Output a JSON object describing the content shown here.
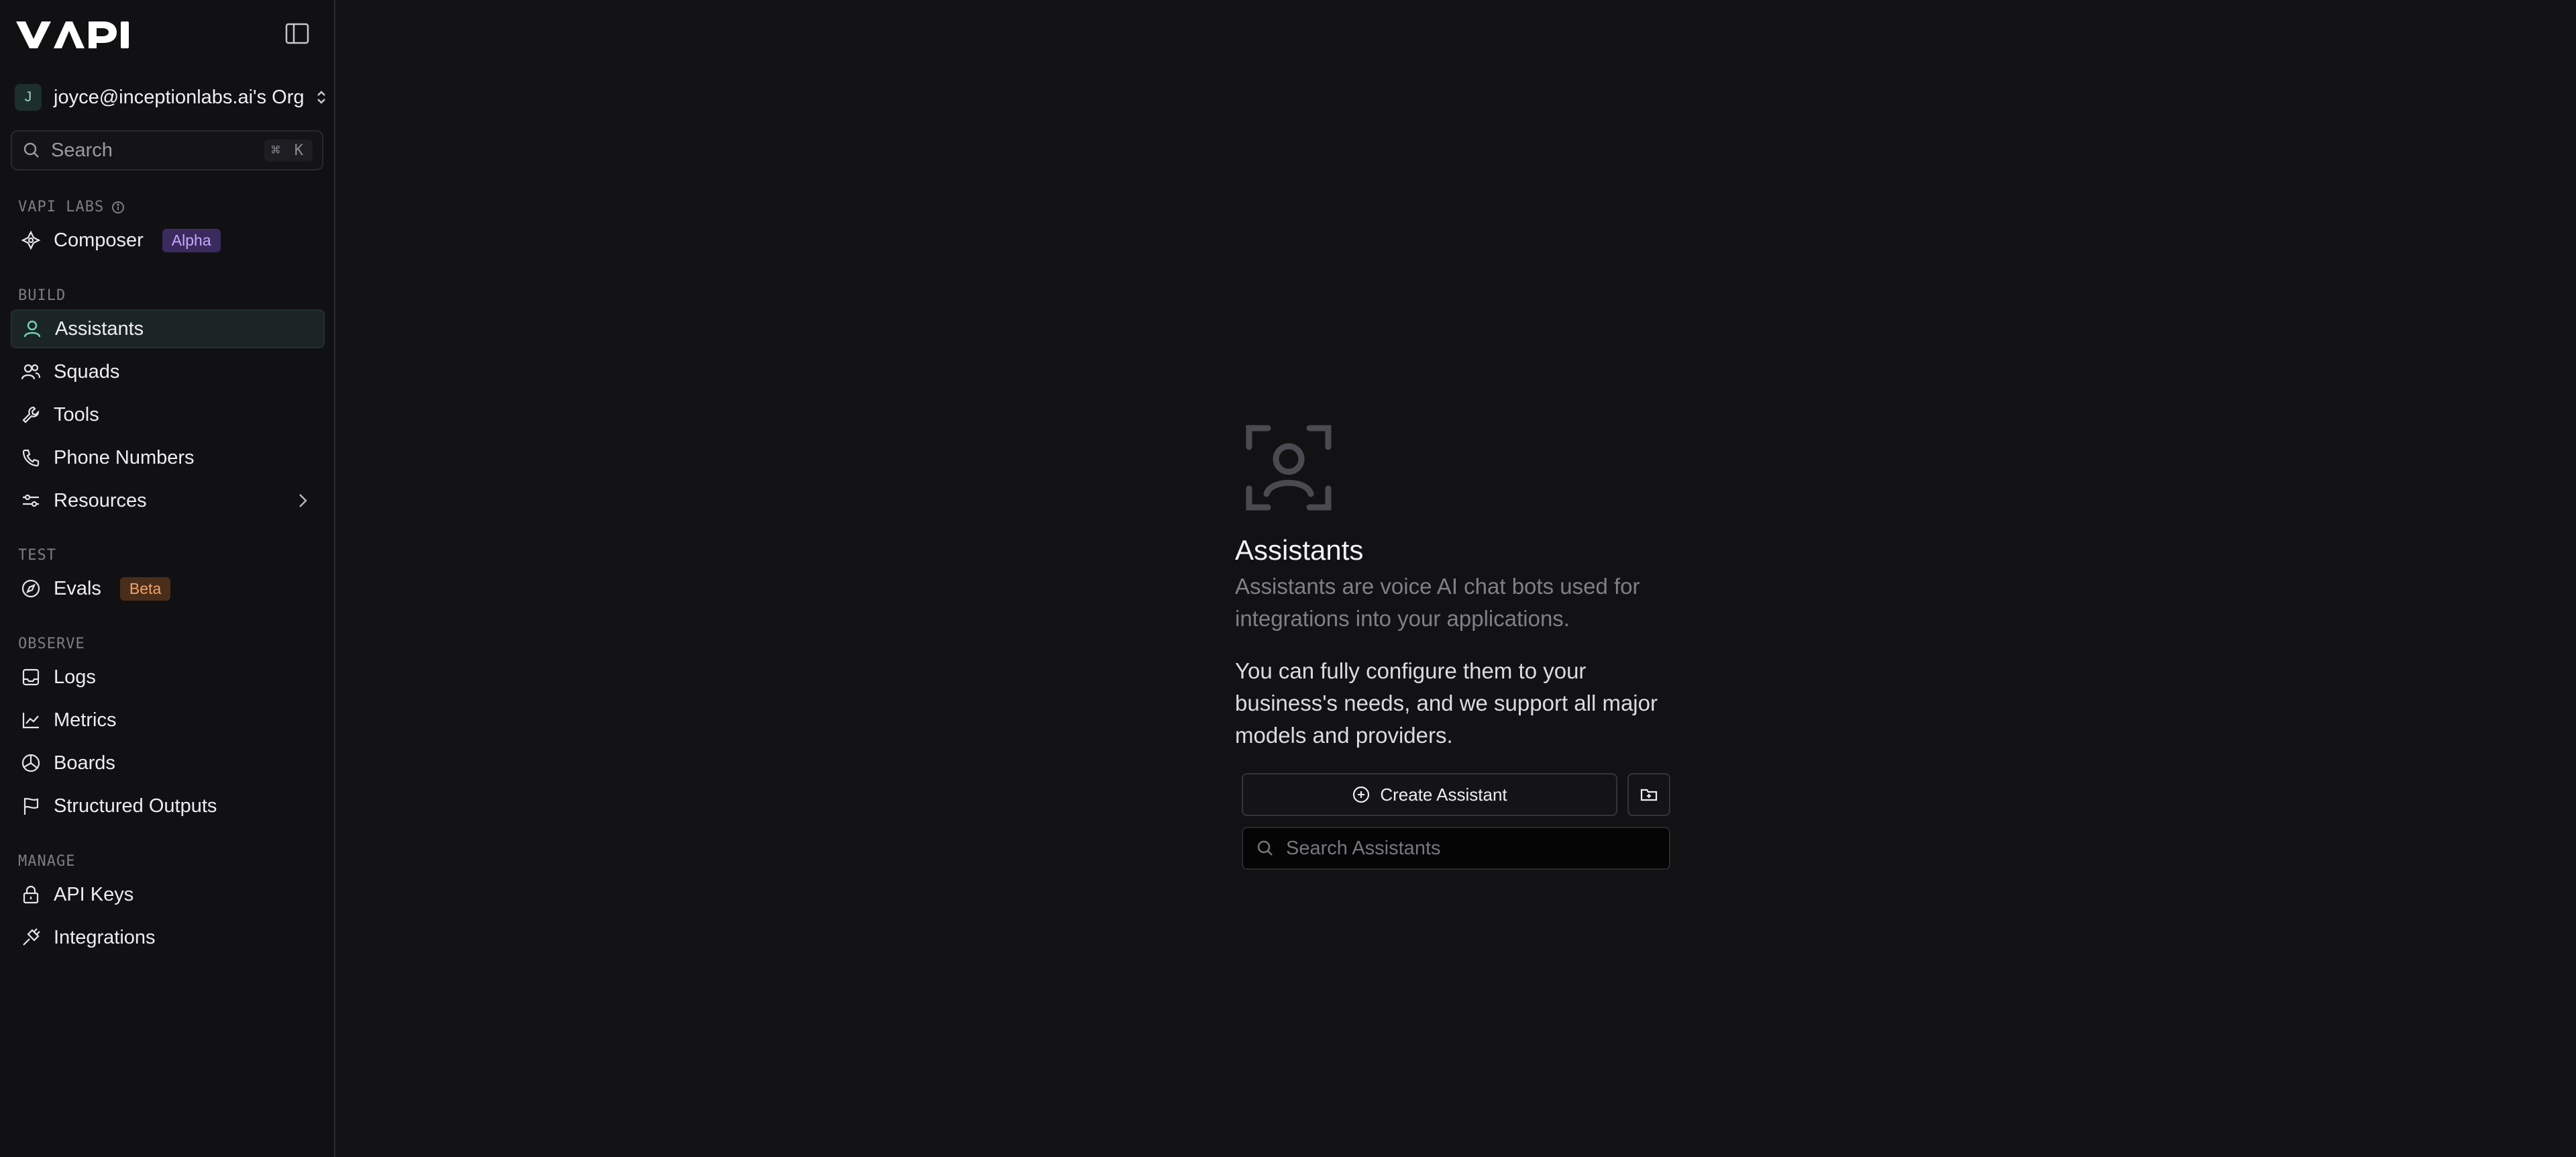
{
  "brand": {
    "logo_text": "VAPI"
  },
  "org": {
    "avatar_letter": "J",
    "name": "joyce@inceptionlabs.ai's Org"
  },
  "search": {
    "label": "Search",
    "shortcut": "⌘ K"
  },
  "sections": {
    "labs": "VAPI LABS",
    "build": "BUILD",
    "test": "TEST",
    "observe": "OBSERVE",
    "manage": "MANAGE"
  },
  "nav": {
    "composer": {
      "label": "Composer",
      "badge": "Alpha",
      "icon": "composer-icon"
    },
    "assistants": {
      "label": "Assistants",
      "icon": "user-icon",
      "active": true
    },
    "squads": {
      "label": "Squads",
      "icon": "users-icon"
    },
    "tools": {
      "label": "Tools",
      "icon": "wrench-icon"
    },
    "phone_numbers": {
      "label": "Phone Numbers",
      "icon": "phone-icon"
    },
    "resources": {
      "label": "Resources",
      "icon": "sliders-icon"
    },
    "evals": {
      "label": "Evals",
      "badge": "Beta",
      "icon": "compass-icon"
    },
    "logs": {
      "label": "Logs",
      "icon": "inbox-icon"
    },
    "metrics": {
      "label": "Metrics",
      "icon": "line-chart-icon"
    },
    "boards": {
      "label": "Boards",
      "icon": "pie-chart-icon"
    },
    "structured_outputs": {
      "label": "Structured Outputs",
      "icon": "flag-icon"
    },
    "api_keys": {
      "label": "API Keys",
      "icon": "lock-icon"
    },
    "integrations": {
      "label": "Integrations",
      "icon": "plug-icon"
    }
  },
  "main": {
    "title": "Assistants",
    "description": "Assistants are voice AI chat bots used for integrations into your applications.",
    "description2": "You can fully configure them to your business's needs, and we support all major models and providers.",
    "create_label": "Create Assistant",
    "search_placeholder": "Search Assistants"
  },
  "colors": {
    "background": "#121214",
    "sidebar": "#111113",
    "active_item": "#1b2624",
    "alpha_badge": "#3a2a5e",
    "beta_badge": "#4a2e1a"
  }
}
